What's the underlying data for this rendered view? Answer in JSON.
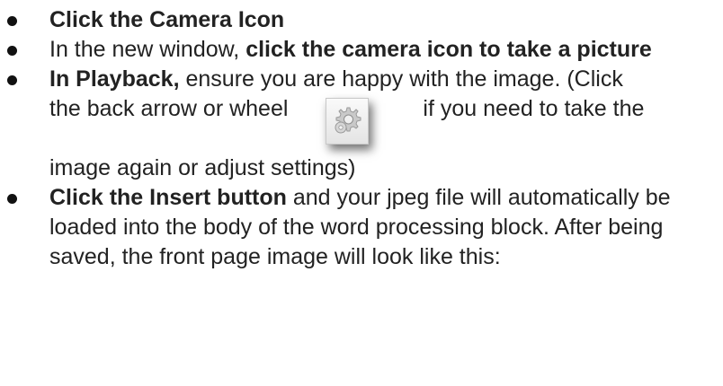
{
  "steps": [
    {
      "bold": "Click the Camera Icon"
    },
    {
      "pre": "In the new window, ",
      "bold": "click the camera icon to take a picture"
    },
    {
      "bold": "In Playback,",
      "line1": " ensure you are happy with the image. (Click",
      "line2a": "the back arrow or wheel",
      "line2b": "if you need to take the",
      "line3": "image again or adjust settings)"
    },
    {
      "bold": "Click the Insert button",
      "rest": " and your jpeg file will automatically be loaded into the body of the word processing block. After being saved, the front page image will look like this:"
    }
  ],
  "icons": {
    "settings": "gear-icon"
  }
}
